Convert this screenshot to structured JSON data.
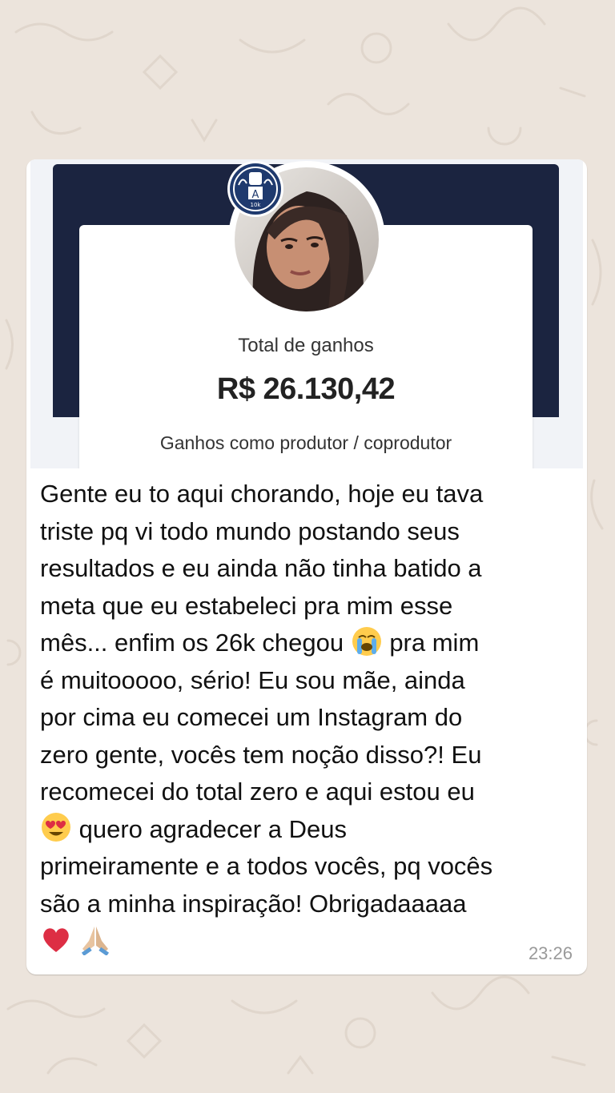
{
  "chat": {
    "background_color": "#ece4dc",
    "message": {
      "image": {
        "card_title": "Total de ganhos",
        "amount": "R$ 26.130,42",
        "subtitle": "Ganhos como produtor / coprodutor",
        "banner_color": "#1b2440",
        "badge_icon": "fist-raised-icon",
        "badge_text": "10k",
        "badge_letter": "A"
      },
      "text": {
        "line1": "Gente eu to aqui chorando, hoje eu tava",
        "line2": "triste pq vi todo mundo postando seus",
        "line3": "resultados e eu ainda não tinha batido a",
        "line4": "meta que eu estabeleci pra mim esse",
        "line5a": "mês... enfim os 26k chegou ",
        "line5b": " pra mim",
        "line6": "é muitooooo, sério! Eu sou mãe, ainda",
        "line7": "por cima eu comecei um Instagram do",
        "line8": "zero gente, vocês tem noção disso?! Eu",
        "line9": "recomecei do total zero e aqui estou eu",
        "line10": " quero agradecer a Deus",
        "line11": "primeiramente e a todos vocês, pq vocês",
        "line12": "são a minha inspiração! Obrigadaaaaa"
      },
      "emojis": {
        "crying": "loudly-crying-face-icon",
        "heart_eyes": "heart-eyes-face-icon",
        "red_heart": "red-heart-icon",
        "praying": "folded-hands-icon"
      },
      "time": "23:26"
    }
  }
}
